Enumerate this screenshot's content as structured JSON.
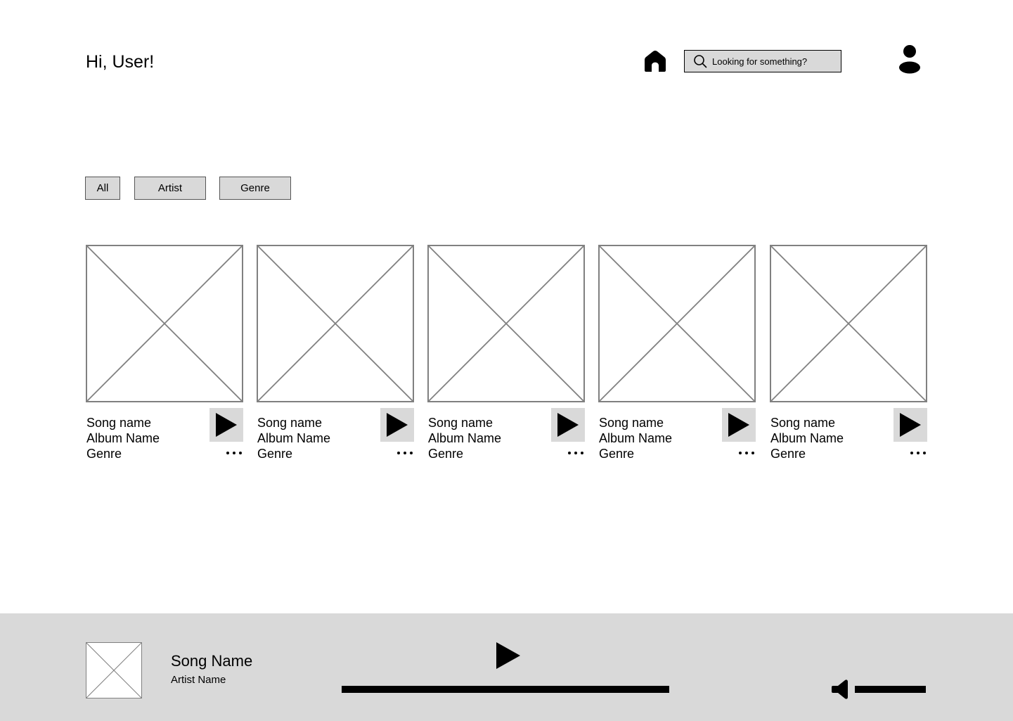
{
  "header": {
    "greeting": "Hi, User!",
    "search_placeholder": "Looking for something?"
  },
  "filters": [
    {
      "label": "All"
    },
    {
      "label": "Artist"
    },
    {
      "label": "Genre"
    }
  ],
  "songs": [
    {
      "song": "Song name",
      "album": "Album Name",
      "genre": "Genre"
    },
    {
      "song": "Song name",
      "album": "Album Name",
      "genre": "Genre"
    },
    {
      "song": "Song name",
      "album": "Album Name",
      "genre": "Genre"
    },
    {
      "song": "Song name",
      "album": "Album Name",
      "genre": "Genre"
    },
    {
      "song": "Song name",
      "album": "Album Name",
      "genre": "Genre"
    }
  ],
  "player": {
    "song_name": "Song Name",
    "artist_name": "Artist Name",
    "progress": 1.0,
    "volume": 1.0
  },
  "colors": {
    "panel": "#d9d9d9",
    "placeholder_stroke": "#808080",
    "ink": "#000000"
  },
  "icons": {
    "home": "home-icon",
    "search": "search-icon",
    "user": "user-icon",
    "play": "play-icon",
    "more": "more-dots-icon",
    "volume": "volume-icon",
    "image_placeholder": "image-placeholder-icon"
  }
}
